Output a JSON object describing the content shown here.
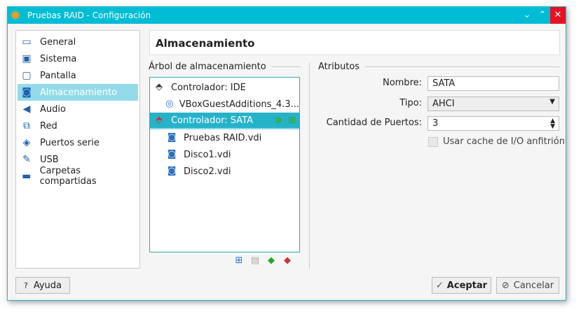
{
  "window": {
    "title": "Pruebas RAID - Configuración",
    "controls": [
      "minimize",
      "maximize",
      "close"
    ]
  },
  "sidebar": {
    "items": [
      {
        "label": "General",
        "icon": "monitor-icon"
      },
      {
        "label": "Sistema",
        "icon": "chip-icon"
      },
      {
        "label": "Pantalla",
        "icon": "display-icon"
      },
      {
        "label": "Almacenamiento",
        "icon": "storage-icon",
        "selected": true
      },
      {
        "label": "Audio",
        "icon": "speaker-icon"
      },
      {
        "label": "Red",
        "icon": "network-icon"
      },
      {
        "label": "Puertos serie",
        "icon": "serial-port-icon"
      },
      {
        "label": "USB",
        "icon": "usb-icon"
      },
      {
        "label": "Carpetas compartidas",
        "icon": "folder-icon"
      }
    ]
  },
  "main": {
    "title": "Almacenamiento",
    "tree_label": "Árbol de almacenamiento",
    "attrs_label": "Atributos",
    "tree": [
      {
        "label": "Controlador: IDE",
        "level": 0
      },
      {
        "label": "VBoxGuestAdditions_4.3...",
        "level": 1
      },
      {
        "label": "Controlador: SATA",
        "level": 0,
        "selected": true
      },
      {
        "label": "Pruebas RAID.vdi",
        "level": 1
      },
      {
        "label": "Disco1.vdi",
        "level": 1
      },
      {
        "label": "Disco2.vdi",
        "level": 1
      }
    ],
    "attrs": {
      "name_label": "Nombre:",
      "name_value": "SATA",
      "type_label": "Tipo:",
      "type_value": "AHCI",
      "ports_label": "Cantidad de Puertos:",
      "ports_value": "3",
      "cache_label": "Usar cache de I/O anfitrión",
      "cache_checked": false
    }
  },
  "footer": {
    "help": "Ayuda",
    "help_icon": "?",
    "ok": "Aceptar",
    "cancel": "Cancelar"
  },
  "colors": {
    "accent": "#00bcd4",
    "selected": "#26b3c9",
    "close": "#e81123"
  }
}
